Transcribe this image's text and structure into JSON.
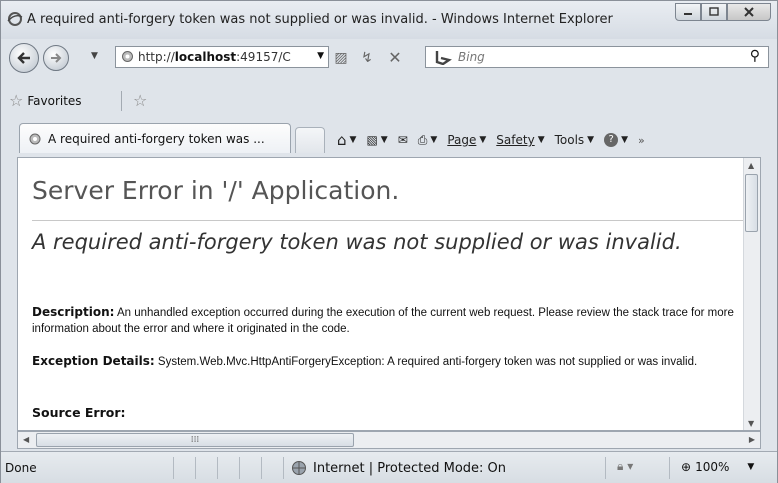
{
  "window": {
    "title": "A required anti-forgery token was not supplied or was invalid. - Windows Internet Explorer"
  },
  "address": {
    "url_prefix": "http://",
    "url_host": "localhost",
    "url_rest": ":49157/C"
  },
  "search": {
    "placeholder": "Bing"
  },
  "favorites": {
    "label": "Favorites"
  },
  "tab": {
    "label": "A required anti-forgery token was ..."
  },
  "commands": {
    "page": "Page",
    "safety": "Safety",
    "tools": "Tools"
  },
  "page": {
    "title": "Server Error in '/' Application.",
    "error_title": "A required anti-forgery token was not supplied or was invalid.",
    "description_label": "Description:",
    "description_text": "An unhandled exception occurred during the execution of the current web request. Please review the stack trace for more information about the error and where it originated in the code.",
    "exception_label": "Exception Details:",
    "exception_text": "System.Web.Mvc.HttpAntiForgeryException: A required anti-forgery token was not supplied or was invalid.",
    "source_error_label": "Source Error:"
  },
  "status": {
    "text": "Done",
    "zone": "Internet | Protected Mode: On",
    "zoom": "100%"
  }
}
